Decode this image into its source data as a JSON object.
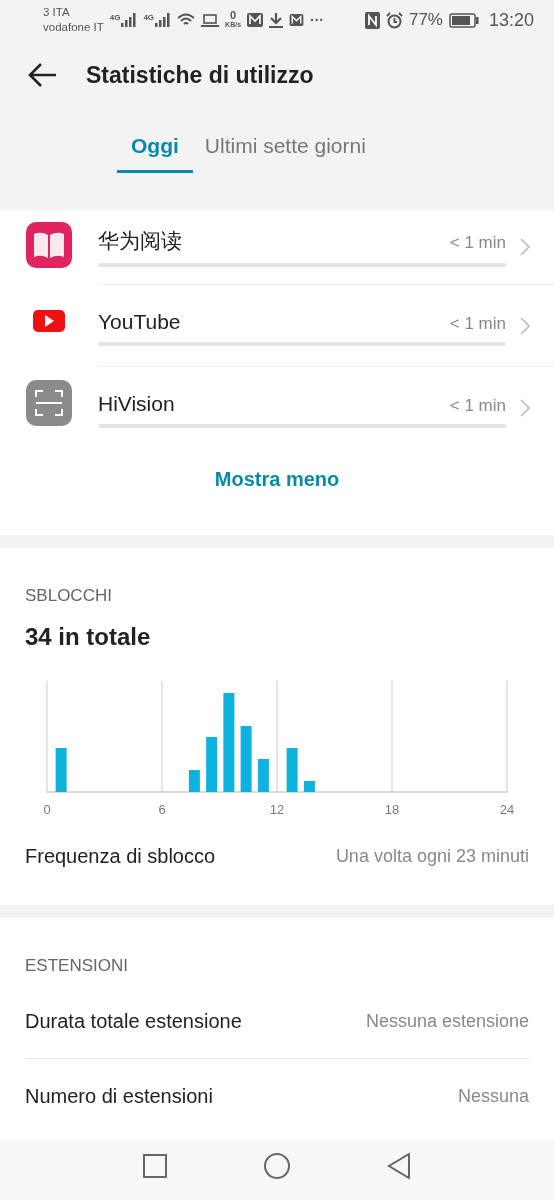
{
  "status_bar": {
    "carrier_1": "3 ITA",
    "carrier_2": "vodafone IT",
    "network_1": "4G",
    "network_2": "4G",
    "speed_value": "0",
    "speed_unit": "KB/s",
    "more": "···",
    "battery": "77%",
    "time": "13:20"
  },
  "header": {
    "title": "Statistiche di utilizzo"
  },
  "tabs": [
    {
      "label": "Oggi",
      "selected": true
    },
    {
      "label": "Ultimi sette giorni",
      "selected": false
    }
  ],
  "apps": [
    {
      "name": "华为阅读",
      "time": "< 1 min",
      "kind": "book"
    },
    {
      "name": "YouTube",
      "time": "< 1 min",
      "kind": "play"
    },
    {
      "name": "HiVision",
      "time": "< 1 min",
      "kind": "scan"
    }
  ],
  "show_less": "Mostra meno",
  "unlocks": {
    "heading": "SBLOCCHI",
    "total": "34 in totale",
    "axis_labels": [
      "0",
      "6",
      "12",
      "18",
      "24"
    ],
    "frequency_label": "Frequenza di sblocco",
    "frequency_value": "Una volta ogni 23 minuti"
  },
  "extensions": {
    "heading": "ESTENSIONI",
    "rows": [
      {
        "label": "Durata totale estensione",
        "value": "Nessuna estensione"
      },
      {
        "label": "Numero di estensioni",
        "value": "Nessuna"
      }
    ]
  }
}
